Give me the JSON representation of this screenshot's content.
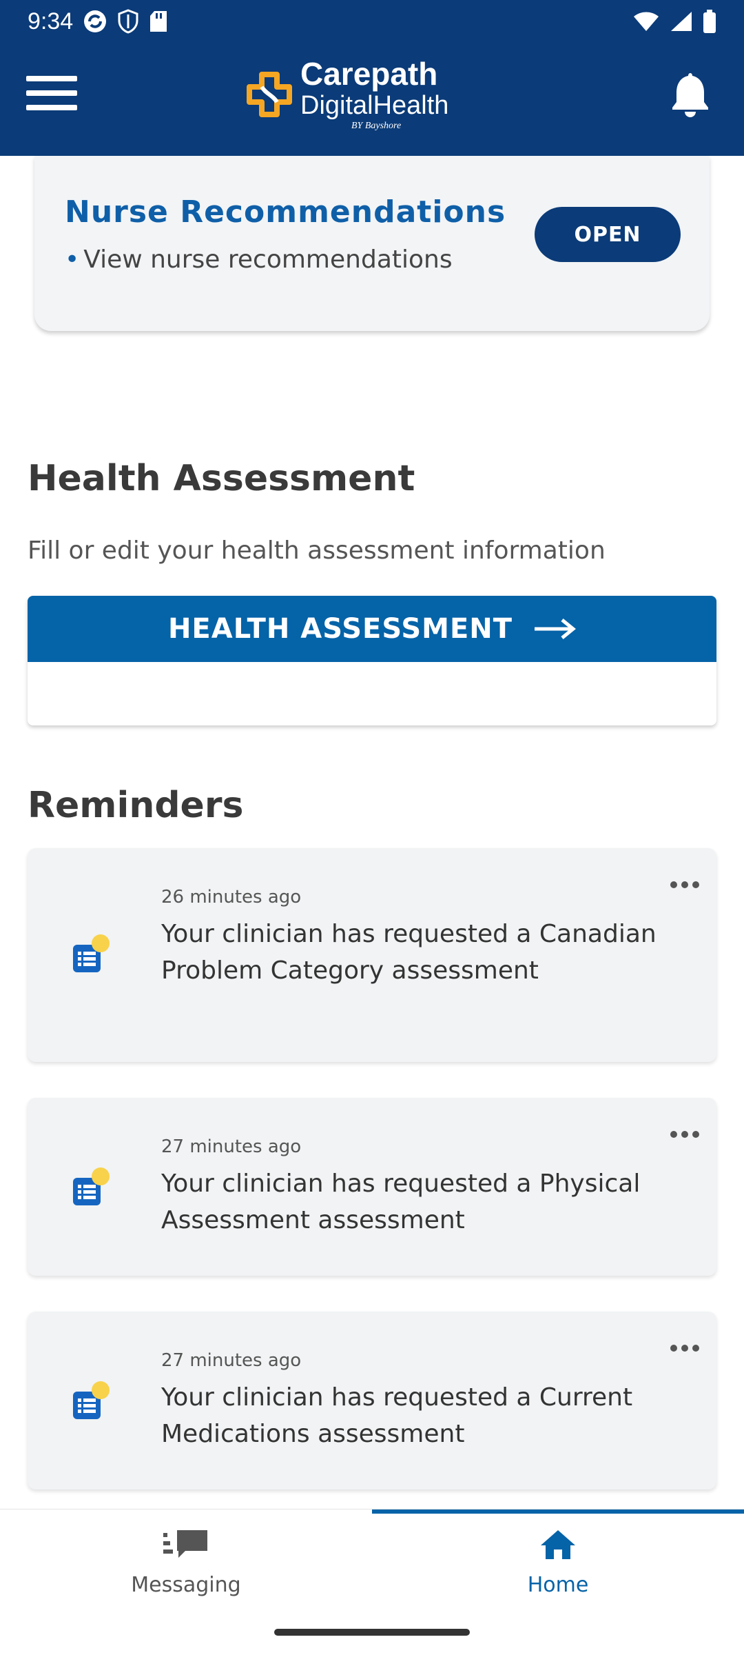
{
  "status": {
    "time": "9:34"
  },
  "header": {
    "logo_line1": "Carepath",
    "logo_line2": "DigitalHealth",
    "logo_line3": "BY Bayshore"
  },
  "nurse_card": {
    "title": "Nurse Recommendations",
    "subtitle": "View nurse recommendations",
    "open_label": "OPEN"
  },
  "health_assessment": {
    "title": "Health Assessment",
    "description": "Fill or edit your health assessment information",
    "button_label": "HEALTH ASSESSMENT"
  },
  "reminders": {
    "title": "Reminders",
    "items": [
      {
        "time": "26 minutes ago",
        "message": "Your clinician has requested a Canadian Problem Category assessment"
      },
      {
        "time": "27 minutes ago",
        "message": "Your clinician has requested a Physical Assessment assessment"
      },
      {
        "time": "27 minutes ago",
        "message": "Your clinician has requested a Current Medications assessment"
      }
    ]
  },
  "bottom_nav": {
    "messaging_label": "Messaging",
    "home_label": "Home",
    "active": "home"
  },
  "colors": {
    "header_bg": "#0b3b78",
    "accent_blue": "#0563a8",
    "title_blue": "#0f5fa8",
    "logo_orange": "#f5a623",
    "badge_yellow": "#f8d24a"
  }
}
